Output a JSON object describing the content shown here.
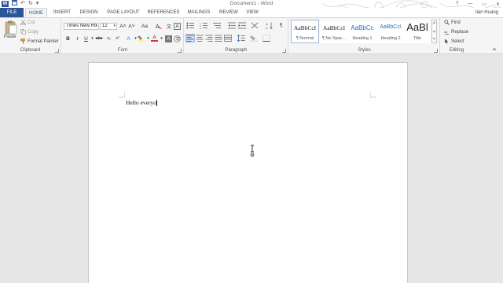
{
  "app": {
    "window_title": "Document1 - Word",
    "user": "Iian Huang"
  },
  "title_bar": {
    "logo_letter": "W",
    "undo_glyph": "↶",
    "redo_glyph": "↻",
    "customize_glyph": "▾",
    "help_glyph": "?",
    "minimize_glyph": "—",
    "restore_glyph": "▭",
    "close_glyph": "✕"
  },
  "tabs": [
    {
      "label": "FILE"
    },
    {
      "label": "HOME"
    },
    {
      "label": "INSERT"
    },
    {
      "label": "DESIGN"
    },
    {
      "label": "PAGE LAYOUT"
    },
    {
      "label": "REFERENCES"
    },
    {
      "label": "MAILINGS"
    },
    {
      "label": "REVIEW"
    },
    {
      "label": "VIEW"
    }
  ],
  "clipboard": {
    "label": "Clipboard",
    "paste": "Paste",
    "cut": "Cut",
    "copy": "Copy",
    "format_painter": "Format Painter"
  },
  "font": {
    "label": "Font",
    "family": "Times New Ro",
    "size": "12",
    "bold": "B",
    "italic": "I",
    "underline": "U",
    "strike": "abc",
    "subscript": "x₂",
    "superscript": "x²",
    "grow": "A˄",
    "shrink": "A˅",
    "change_case": "Aa",
    "font_color": "A",
    "clear_format": "A",
    "border_text": "A",
    "text_effects": "A"
  },
  "paragraph": {
    "label": "Paragraph",
    "show_marks": "¶",
    "sort": "A↓"
  },
  "styles": {
    "label": "Styles",
    "items": [
      {
        "preview": "AaBbCcI",
        "name": "¶ Normal"
      },
      {
        "preview": "AaBbCcI",
        "name": "¶ No Spac..."
      },
      {
        "preview": "AaBbCc",
        "name": "Heading 1"
      },
      {
        "preview": "AaBbCcI",
        "name": "Heading 2"
      },
      {
        "preview": "AaBl",
        "name": "Title"
      }
    ]
  },
  "editing": {
    "label": "Editing",
    "find": "Find",
    "replace": "Replace",
    "select": "Select"
  },
  "document": {
    "text": "Hello everyo"
  },
  "colors": {
    "accent": "#2b579a",
    "ribbon": "#f5f5f5",
    "canvas": "#e6e6e6",
    "font_color_bar": "#e03030",
    "highlight_bar": "#ffff00"
  }
}
